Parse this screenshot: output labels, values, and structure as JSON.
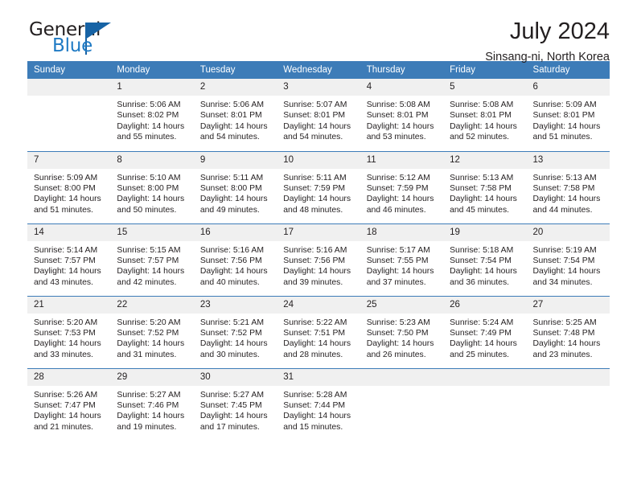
{
  "brand": {
    "name_part1": "General",
    "name_part2": "Blue",
    "triangle_color": "#1763a5",
    "blue_text_color": "#1f7ac4"
  },
  "header": {
    "title": "July 2024",
    "subtitle": "Sinsang-ni, North Korea"
  },
  "theme": {
    "header_row_bg": "#3d7cb8",
    "daynum_bg": "#f0f0f0",
    "text_color": "#231f20"
  },
  "weekdays": [
    "Sunday",
    "Monday",
    "Tuesday",
    "Wednesday",
    "Thursday",
    "Friday",
    "Saturday"
  ],
  "weeks": [
    [
      {
        "day": "",
        "sunrise": "",
        "sunset": "",
        "daylight_line1": "",
        "daylight_line2": ""
      },
      {
        "day": "1",
        "sunrise": "Sunrise: 5:06 AM",
        "sunset": "Sunset: 8:02 PM",
        "daylight_line1": "Daylight: 14 hours",
        "daylight_line2": "and 55 minutes."
      },
      {
        "day": "2",
        "sunrise": "Sunrise: 5:06 AM",
        "sunset": "Sunset: 8:01 PM",
        "daylight_line1": "Daylight: 14 hours",
        "daylight_line2": "and 54 minutes."
      },
      {
        "day": "3",
        "sunrise": "Sunrise: 5:07 AM",
        "sunset": "Sunset: 8:01 PM",
        "daylight_line1": "Daylight: 14 hours",
        "daylight_line2": "and 54 minutes."
      },
      {
        "day": "4",
        "sunrise": "Sunrise: 5:08 AM",
        "sunset": "Sunset: 8:01 PM",
        "daylight_line1": "Daylight: 14 hours",
        "daylight_line2": "and 53 minutes."
      },
      {
        "day": "5",
        "sunrise": "Sunrise: 5:08 AM",
        "sunset": "Sunset: 8:01 PM",
        "daylight_line1": "Daylight: 14 hours",
        "daylight_line2": "and 52 minutes."
      },
      {
        "day": "6",
        "sunrise": "Sunrise: 5:09 AM",
        "sunset": "Sunset: 8:01 PM",
        "daylight_line1": "Daylight: 14 hours",
        "daylight_line2": "and 51 minutes."
      }
    ],
    [
      {
        "day": "7",
        "sunrise": "Sunrise: 5:09 AM",
        "sunset": "Sunset: 8:00 PM",
        "daylight_line1": "Daylight: 14 hours",
        "daylight_line2": "and 51 minutes."
      },
      {
        "day": "8",
        "sunrise": "Sunrise: 5:10 AM",
        "sunset": "Sunset: 8:00 PM",
        "daylight_line1": "Daylight: 14 hours",
        "daylight_line2": "and 50 minutes."
      },
      {
        "day": "9",
        "sunrise": "Sunrise: 5:11 AM",
        "sunset": "Sunset: 8:00 PM",
        "daylight_line1": "Daylight: 14 hours",
        "daylight_line2": "and 49 minutes."
      },
      {
        "day": "10",
        "sunrise": "Sunrise: 5:11 AM",
        "sunset": "Sunset: 7:59 PM",
        "daylight_line1": "Daylight: 14 hours",
        "daylight_line2": "and 48 minutes."
      },
      {
        "day": "11",
        "sunrise": "Sunrise: 5:12 AM",
        "sunset": "Sunset: 7:59 PM",
        "daylight_line1": "Daylight: 14 hours",
        "daylight_line2": "and 46 minutes."
      },
      {
        "day": "12",
        "sunrise": "Sunrise: 5:13 AM",
        "sunset": "Sunset: 7:58 PM",
        "daylight_line1": "Daylight: 14 hours",
        "daylight_line2": "and 45 minutes."
      },
      {
        "day": "13",
        "sunrise": "Sunrise: 5:13 AM",
        "sunset": "Sunset: 7:58 PM",
        "daylight_line1": "Daylight: 14 hours",
        "daylight_line2": "and 44 minutes."
      }
    ],
    [
      {
        "day": "14",
        "sunrise": "Sunrise: 5:14 AM",
        "sunset": "Sunset: 7:57 PM",
        "daylight_line1": "Daylight: 14 hours",
        "daylight_line2": "and 43 minutes."
      },
      {
        "day": "15",
        "sunrise": "Sunrise: 5:15 AM",
        "sunset": "Sunset: 7:57 PM",
        "daylight_line1": "Daylight: 14 hours",
        "daylight_line2": "and 42 minutes."
      },
      {
        "day": "16",
        "sunrise": "Sunrise: 5:16 AM",
        "sunset": "Sunset: 7:56 PM",
        "daylight_line1": "Daylight: 14 hours",
        "daylight_line2": "and 40 minutes."
      },
      {
        "day": "17",
        "sunrise": "Sunrise: 5:16 AM",
        "sunset": "Sunset: 7:56 PM",
        "daylight_line1": "Daylight: 14 hours",
        "daylight_line2": "and 39 minutes."
      },
      {
        "day": "18",
        "sunrise": "Sunrise: 5:17 AM",
        "sunset": "Sunset: 7:55 PM",
        "daylight_line1": "Daylight: 14 hours",
        "daylight_line2": "and 37 minutes."
      },
      {
        "day": "19",
        "sunrise": "Sunrise: 5:18 AM",
        "sunset": "Sunset: 7:54 PM",
        "daylight_line1": "Daylight: 14 hours",
        "daylight_line2": "and 36 minutes."
      },
      {
        "day": "20",
        "sunrise": "Sunrise: 5:19 AM",
        "sunset": "Sunset: 7:54 PM",
        "daylight_line1": "Daylight: 14 hours",
        "daylight_line2": "and 34 minutes."
      }
    ],
    [
      {
        "day": "21",
        "sunrise": "Sunrise: 5:20 AM",
        "sunset": "Sunset: 7:53 PM",
        "daylight_line1": "Daylight: 14 hours",
        "daylight_line2": "and 33 minutes."
      },
      {
        "day": "22",
        "sunrise": "Sunrise: 5:20 AM",
        "sunset": "Sunset: 7:52 PM",
        "daylight_line1": "Daylight: 14 hours",
        "daylight_line2": "and 31 minutes."
      },
      {
        "day": "23",
        "sunrise": "Sunrise: 5:21 AM",
        "sunset": "Sunset: 7:52 PM",
        "daylight_line1": "Daylight: 14 hours",
        "daylight_line2": "and 30 minutes."
      },
      {
        "day": "24",
        "sunrise": "Sunrise: 5:22 AM",
        "sunset": "Sunset: 7:51 PM",
        "daylight_line1": "Daylight: 14 hours",
        "daylight_line2": "and 28 minutes."
      },
      {
        "day": "25",
        "sunrise": "Sunrise: 5:23 AM",
        "sunset": "Sunset: 7:50 PM",
        "daylight_line1": "Daylight: 14 hours",
        "daylight_line2": "and 26 minutes."
      },
      {
        "day": "26",
        "sunrise": "Sunrise: 5:24 AM",
        "sunset": "Sunset: 7:49 PM",
        "daylight_line1": "Daylight: 14 hours",
        "daylight_line2": "and 25 minutes."
      },
      {
        "day": "27",
        "sunrise": "Sunrise: 5:25 AM",
        "sunset": "Sunset: 7:48 PM",
        "daylight_line1": "Daylight: 14 hours",
        "daylight_line2": "and 23 minutes."
      }
    ],
    [
      {
        "day": "28",
        "sunrise": "Sunrise: 5:26 AM",
        "sunset": "Sunset: 7:47 PM",
        "daylight_line1": "Daylight: 14 hours",
        "daylight_line2": "and 21 minutes."
      },
      {
        "day": "29",
        "sunrise": "Sunrise: 5:27 AM",
        "sunset": "Sunset: 7:46 PM",
        "daylight_line1": "Daylight: 14 hours",
        "daylight_line2": "and 19 minutes."
      },
      {
        "day": "30",
        "sunrise": "Sunrise: 5:27 AM",
        "sunset": "Sunset: 7:45 PM",
        "daylight_line1": "Daylight: 14 hours",
        "daylight_line2": "and 17 minutes."
      },
      {
        "day": "31",
        "sunrise": "Sunrise: 5:28 AM",
        "sunset": "Sunset: 7:44 PM",
        "daylight_line1": "Daylight: 14 hours",
        "daylight_line2": "and 15 minutes."
      },
      {
        "day": "",
        "sunrise": "",
        "sunset": "",
        "daylight_line1": "",
        "daylight_line2": ""
      },
      {
        "day": "",
        "sunrise": "",
        "sunset": "",
        "daylight_line1": "",
        "daylight_line2": ""
      },
      {
        "day": "",
        "sunrise": "",
        "sunset": "",
        "daylight_line1": "",
        "daylight_line2": ""
      }
    ]
  ]
}
